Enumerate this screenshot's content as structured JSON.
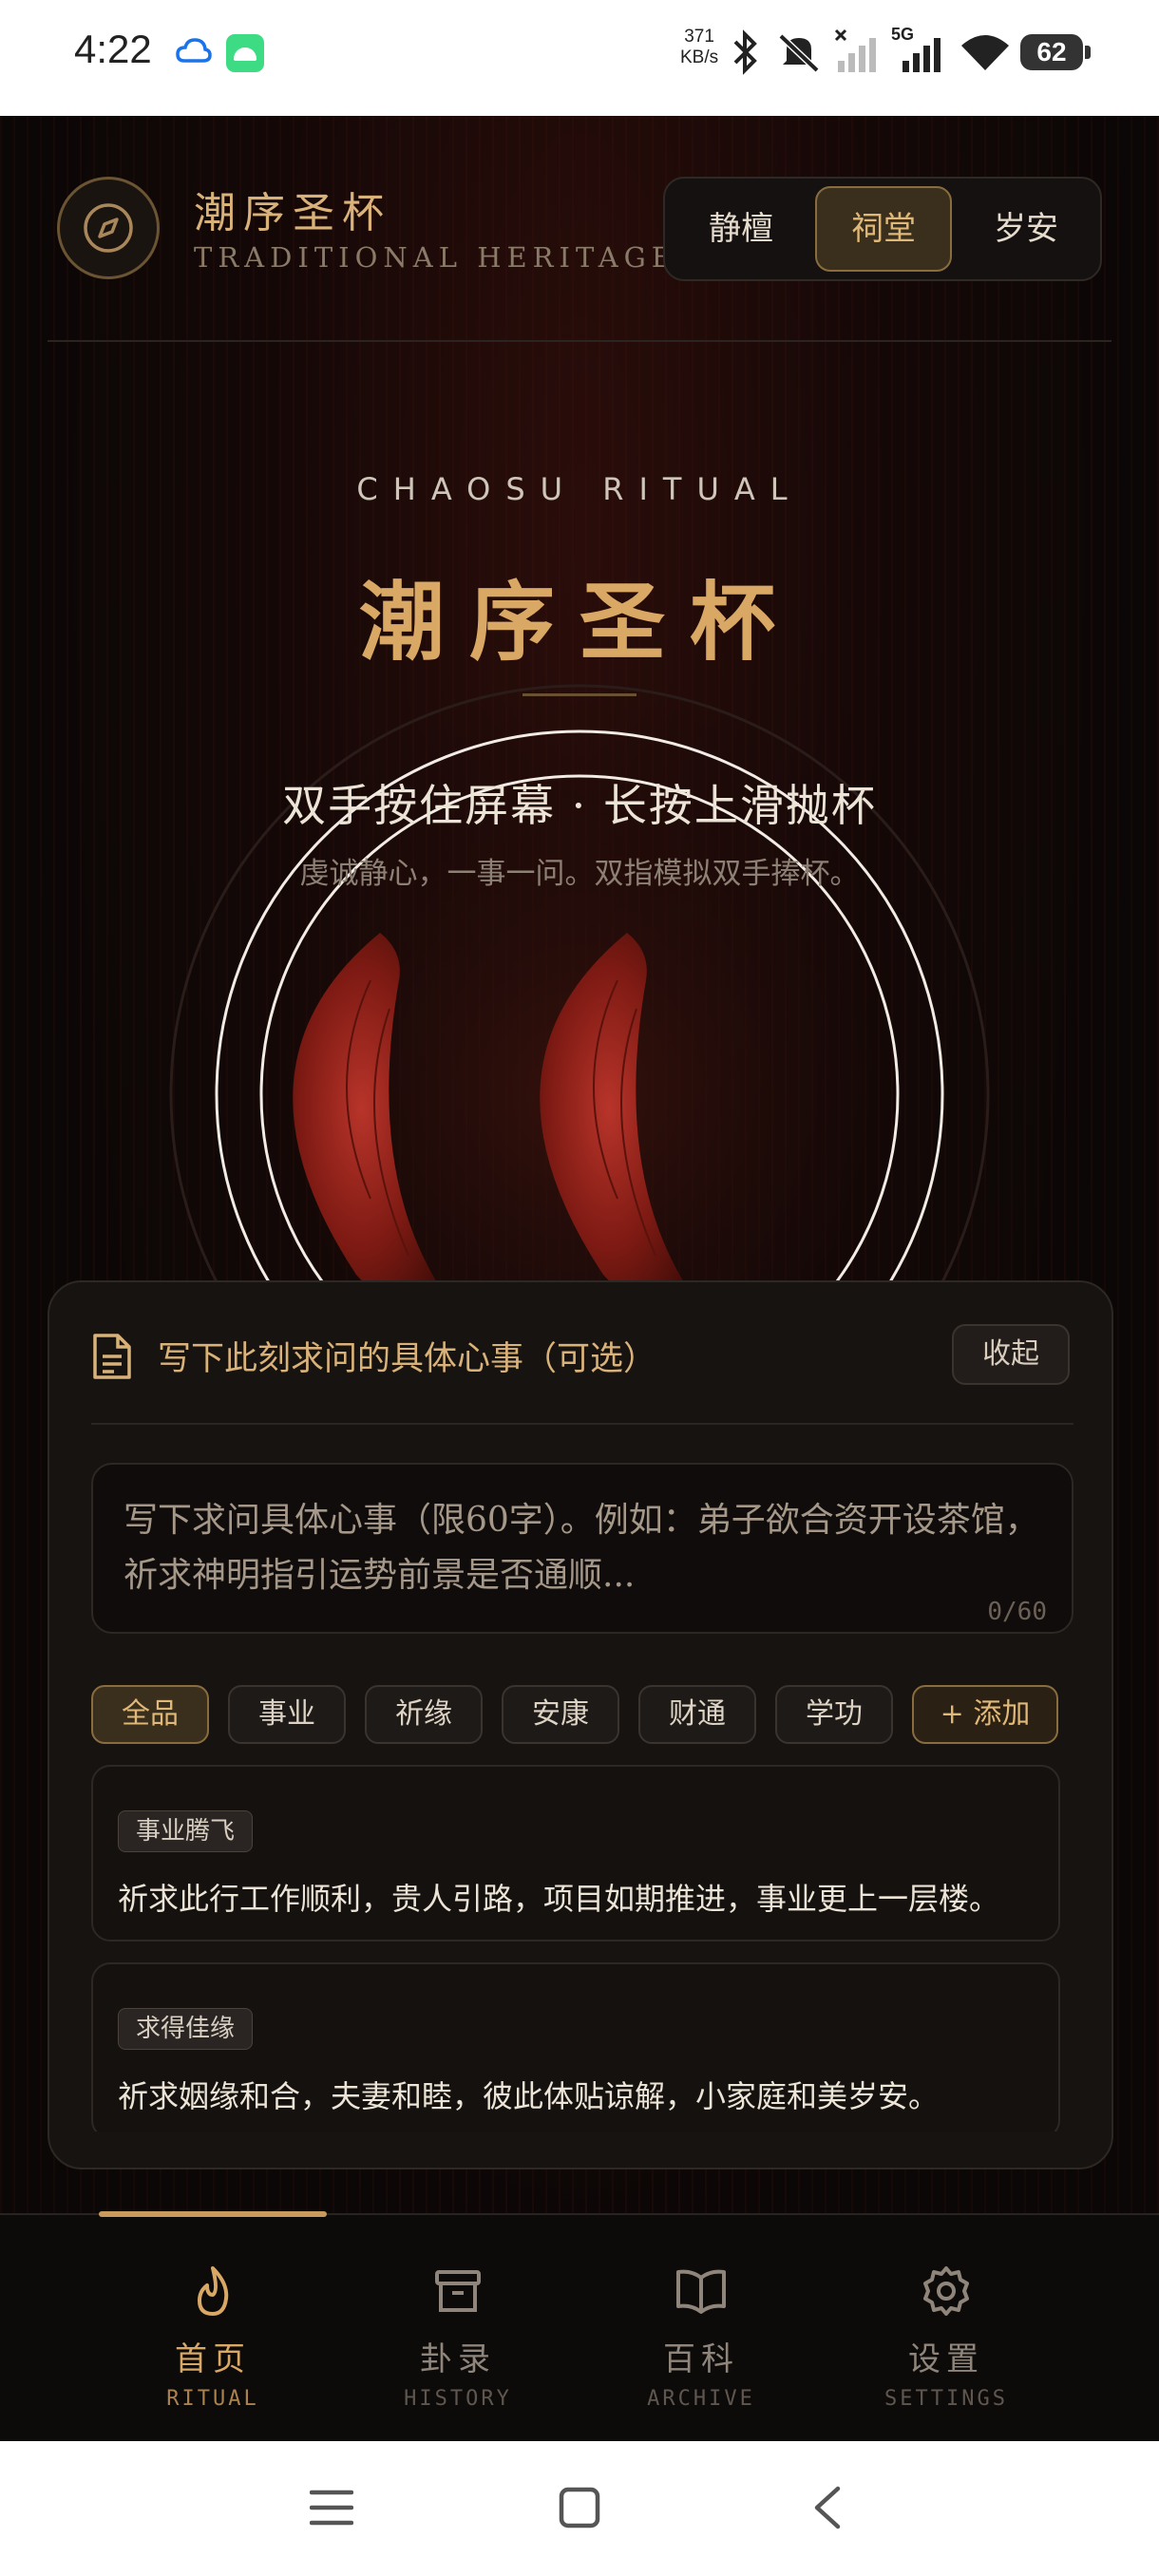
{
  "status_bar": {
    "time": "4:22",
    "net_speed_value": "371",
    "net_speed_unit": "KB/s",
    "network_label": "5G",
    "battery": "62"
  },
  "header": {
    "title": "潮序圣杯",
    "subtitle": "TRADITIONAL HERITAGE",
    "theme_tabs": [
      {
        "label": "静檀",
        "active": false
      },
      {
        "label": "祠堂",
        "active": true
      },
      {
        "label": "岁安",
        "active": false
      }
    ]
  },
  "hero": {
    "en_title": "CHAOSU RITUAL",
    "title": "潮序圣杯",
    "hint": "双手按住屏幕 · 长按上滑抛杯",
    "hint_sub": "虔诚静心，一事一问。双指模拟双手捧杯。"
  },
  "panel": {
    "title": "写下此刻求问的具体心事（可选）",
    "collapse_label": "收起",
    "textarea": {
      "placeholder": "写下求问具体心事（限60字）。例如：弟子欲合资开设茶馆，祈求神明指引运势前景是否通顺...",
      "value": "",
      "counter": "0/60"
    },
    "categories": [
      {
        "label": "全品",
        "active": true
      },
      {
        "label": "事业",
        "active": false
      },
      {
        "label": "祈缘",
        "active": false
      },
      {
        "label": "安康",
        "active": false
      },
      {
        "label": "财通",
        "active": false
      },
      {
        "label": "学功",
        "active": false
      }
    ],
    "add_label": "+ 添加",
    "presets": [
      {
        "tag": "事业腾飞",
        "text": "祈求此行工作顺利，贵人引路，项目如期推进，事业更上一层楼。"
      },
      {
        "tag": "求得佳缘",
        "text": "祈求姻缘和合，夫妻和睦，彼此体贴谅解，小家庭和美岁安。"
      }
    ]
  },
  "bottom_nav": [
    {
      "label": "首页",
      "sub": "RITUAL",
      "icon": "flame-icon",
      "active": true
    },
    {
      "label": "卦录",
      "sub": "HISTORY",
      "icon": "archive-box-icon",
      "active": false
    },
    {
      "label": "百科",
      "sub": "ARCHIVE",
      "icon": "book-icon",
      "active": false
    },
    {
      "label": "设置",
      "sub": "SETTINGS",
      "icon": "gear-icon",
      "active": false
    }
  ],
  "colors": {
    "accent_gold": "#d9a865",
    "cup_red": "#8e1f17",
    "background": "#0b0807"
  }
}
